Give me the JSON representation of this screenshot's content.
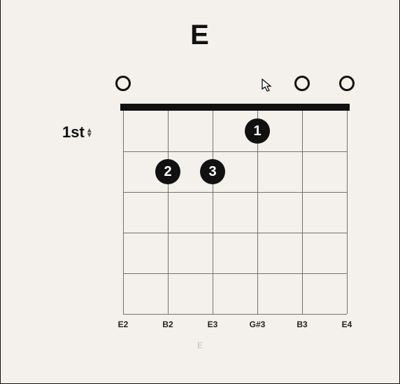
{
  "chord": {
    "name": "E",
    "footer_label": "E"
  },
  "fret_position": {
    "label": "1st"
  },
  "board": {
    "num_strings": 6,
    "num_frets": 5
  },
  "strings": [
    {
      "note": "E2",
      "open": true
    },
    {
      "note": "B2",
      "open": false
    },
    {
      "note": "E3",
      "open": false
    },
    {
      "note": "G#3",
      "open": false
    },
    {
      "note": "B3",
      "open": true
    },
    {
      "note": "E4",
      "open": true
    }
  ],
  "fingers": [
    {
      "label": "1",
      "string_index": 3,
      "fret": 1
    },
    {
      "label": "2",
      "string_index": 1,
      "fret": 2
    },
    {
      "label": "3",
      "string_index": 2,
      "fret": 2
    }
  ]
}
